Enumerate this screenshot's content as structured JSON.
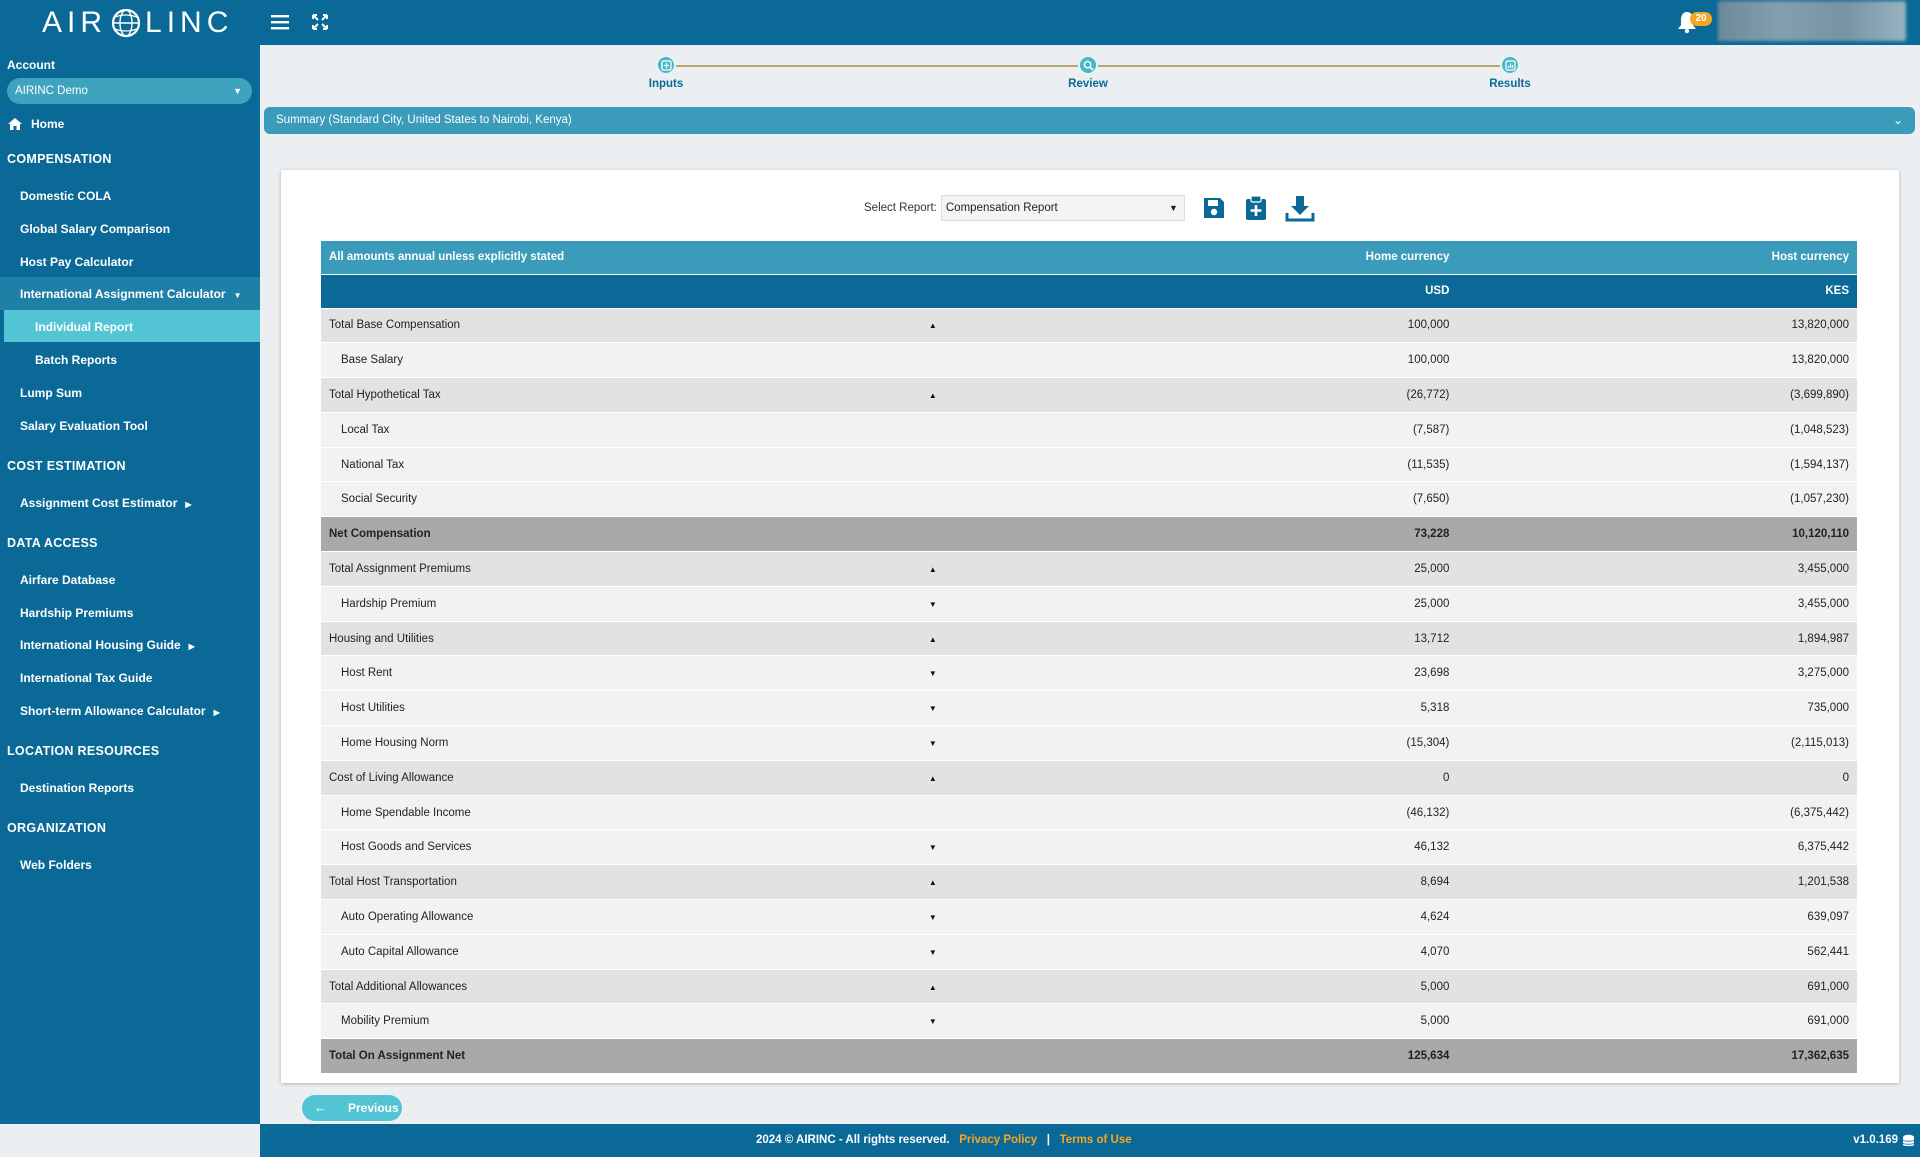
{
  "app": {
    "logo_left": "AIR",
    "logo_right": "LINC",
    "notification_count": "20",
    "colors": {
      "primary": "#0a6996",
      "accent": "#3a9bbb",
      "active": "#52c4d4",
      "link": "#f5a623"
    }
  },
  "sidebar": {
    "account_label": "Account",
    "account_value": "AIRINC Demo",
    "home": "Home",
    "sections": {
      "compensation": "COMPENSATION",
      "cost_estimation": "COST ESTIMATION",
      "data_access": "DATA ACCESS",
      "location_resources": "LOCATION RESOURCES",
      "organization": "ORGANIZATION"
    },
    "items": {
      "domestic_cola": "Domestic COLA",
      "global_salary": "Global Salary Comparison",
      "host_pay": "Host Pay Calculator",
      "iac": "International Assignment Calculator",
      "individual_report": "Individual Report",
      "batch_reports": "Batch Reports",
      "lump_sum": "Lump Sum",
      "salary_eval": "Salary Evaluation Tool",
      "ace": "Assignment Cost Estimator",
      "airfare": "Airfare Database",
      "hardship": "Hardship Premiums",
      "housing_guide": "International Housing Guide",
      "tax_guide": "International Tax Guide",
      "short_term": "Short-term Allowance Calculator",
      "destination": "Destination Reports",
      "web_folders": "Web Folders"
    }
  },
  "stepper": {
    "inputs": "Inputs",
    "review": "Review",
    "results": "Results"
  },
  "summary": "Summary (Standard City, United States to Nairobi, Kenya)",
  "report": {
    "select_label": "Select Report:",
    "selected": "Compensation Report",
    "header": {
      "note": "All amounts annual unless explicitly stated",
      "home_currency": "Home currency",
      "host_currency": "Host currency",
      "home_code": "USD",
      "host_code": "KES"
    },
    "rows": [
      {
        "label": "Total Base Compensation",
        "type": "group",
        "toggle": "▲",
        "home": "100,000",
        "host": "13,820,000"
      },
      {
        "label": "Base Salary",
        "type": "child",
        "toggle": "",
        "home": "100,000",
        "host": "13,820,000"
      },
      {
        "label": "Total Hypothetical Tax",
        "type": "group",
        "toggle": "▲",
        "home": "(26,772)",
        "host": "(3,699,890)"
      },
      {
        "label": "Local Tax",
        "type": "child",
        "toggle": "",
        "home": "(7,587)",
        "host": "(1,048,523)"
      },
      {
        "label": "National Tax",
        "type": "child",
        "toggle": "",
        "home": "(11,535)",
        "host": "(1,594,137)"
      },
      {
        "label": "Social Security",
        "type": "child",
        "toggle": "",
        "home": "(7,650)",
        "host": "(1,057,230)"
      },
      {
        "label": "Net Compensation",
        "type": "total",
        "toggle": "",
        "home": "73,228",
        "host": "10,120,110"
      },
      {
        "label": "Total Assignment Premiums",
        "type": "group",
        "toggle": "▲",
        "home": "25,000",
        "host": "3,455,000"
      },
      {
        "label": "Hardship Premium",
        "type": "child",
        "toggle": "▼",
        "home": "25,000",
        "host": "3,455,000"
      },
      {
        "label": "Housing and Utilities",
        "type": "group",
        "toggle": "▲",
        "home": "13,712",
        "host": "1,894,987"
      },
      {
        "label": "Host Rent",
        "type": "child",
        "toggle": "▼",
        "home": "23,698",
        "host": "3,275,000"
      },
      {
        "label": "Host Utilities",
        "type": "child",
        "toggle": "▼",
        "home": "5,318",
        "host": "735,000"
      },
      {
        "label": "Home Housing Norm",
        "type": "child",
        "toggle": "▼",
        "home": "(15,304)",
        "host": "(2,115,013)"
      },
      {
        "label": "Cost of Living Allowance",
        "type": "group",
        "toggle": "▲",
        "home": "0",
        "host": "0"
      },
      {
        "label": "Home Spendable Income",
        "type": "child",
        "toggle": "",
        "home": "(46,132)",
        "host": "(6,375,442)"
      },
      {
        "label": "Host Goods and Services",
        "type": "child",
        "toggle": "▼",
        "home": "46,132",
        "host": "6,375,442"
      },
      {
        "label": "Total Host Transportation",
        "type": "group",
        "toggle": "▲",
        "home": "8,694",
        "host": "1,201,538"
      },
      {
        "label": "Auto Operating Allowance",
        "type": "child",
        "toggle": "▼",
        "home": "4,624",
        "host": "639,097"
      },
      {
        "label": "Auto Capital Allowance",
        "type": "child",
        "toggle": "▼",
        "home": "4,070",
        "host": "562,441"
      },
      {
        "label": "Total Additional Allowances",
        "type": "group",
        "toggle": "▲",
        "home": "5,000",
        "host": "691,000"
      },
      {
        "label": "Mobility Premium",
        "type": "child",
        "toggle": "▼",
        "home": "5,000",
        "host": "691,000"
      },
      {
        "label": "Total On Assignment Net",
        "type": "total",
        "toggle": "",
        "home": "125,634",
        "host": "17,362,635"
      }
    ]
  },
  "buttons": {
    "previous": "Previous"
  },
  "footer": {
    "copyright": "2024 © AIRINC - All rights reserved.",
    "privacy": "Privacy Policy",
    "separator": "|",
    "terms": "Terms of Use",
    "version": "v1.0.169"
  }
}
